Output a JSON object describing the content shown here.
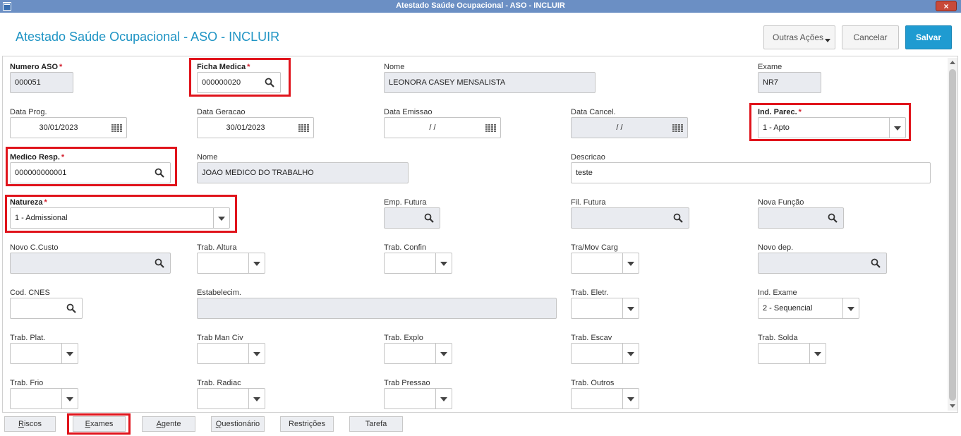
{
  "window": {
    "title": "Atestado Saúde Ocupacional - ASO - INCLUIR",
    "close_label": "×"
  },
  "header": {
    "title": "Atestado Saúde Ocupacional - ASO - INCLUIR",
    "outras_acoes": "Outras Ações",
    "cancelar": "Cancelar",
    "salvar": "Salvar"
  },
  "fields": {
    "numero_aso": {
      "label": "Numero ASO",
      "value": "000051"
    },
    "ficha_medica": {
      "label": "Ficha Medica",
      "value": "000000020"
    },
    "nome_func": {
      "label": "Nome",
      "value": "LEONORA CASEY MENSALISTA"
    },
    "exame": {
      "label": "Exame",
      "value": "NR7"
    },
    "data_prog": {
      "label": "Data Prog.",
      "value": "30/01/2023"
    },
    "data_geracao": {
      "label": "Data Geracao",
      "value": "30/01/2023"
    },
    "data_emissao": {
      "label": "Data Emissao",
      "value": "/ /"
    },
    "data_cancel": {
      "label": "Data Cancel.",
      "value": "/ /"
    },
    "ind_parec": {
      "label": "Ind. Parec.",
      "value": "1 - Apto"
    },
    "medico_resp": {
      "label": "Medico Resp.",
      "value": "000000000001"
    },
    "nome_medico": {
      "label": "Nome",
      "value": "JOAO MEDICO DO TRABALHO"
    },
    "descricao": {
      "label": "Descricao",
      "value": "teste"
    },
    "natureza": {
      "label": "Natureza",
      "value": "1 - Admissional"
    },
    "emp_futura": {
      "label": "Emp. Futura",
      "value": ""
    },
    "fil_futura": {
      "label": "Fil. Futura",
      "value": ""
    },
    "nova_funcao": {
      "label": "Nova Função",
      "value": ""
    },
    "novo_ccusto": {
      "label": "Novo C.Custo",
      "value": ""
    },
    "trab_altura": {
      "label": "Trab. Altura",
      "value": ""
    },
    "trab_confin": {
      "label": "Trab. Confin",
      "value": ""
    },
    "tra_mov_carg": {
      "label": "Tra/Mov Carg",
      "value": ""
    },
    "novo_dep": {
      "label": "Novo dep.",
      "value": ""
    },
    "cod_cnes": {
      "label": "Cod. CNES",
      "value": ""
    },
    "estabelecim": {
      "label": "Estabelecim.",
      "value": ""
    },
    "trab_eletr": {
      "label": "Trab. Eletr.",
      "value": ""
    },
    "ind_exame": {
      "label": "Ind. Exame",
      "value": "2 - Sequencial"
    },
    "trab_plat": {
      "label": "Trab. Plat.",
      "value": ""
    },
    "trab_man_civ": {
      "label": "Trab Man Civ",
      "value": ""
    },
    "trab_explo": {
      "label": "Trab. Explo",
      "value": ""
    },
    "trab_escav": {
      "label": "Trab. Escav",
      "value": ""
    },
    "trab_solda": {
      "label": "Trab. Solda",
      "value": ""
    },
    "trab_frio": {
      "label": "Trab. Frio",
      "value": ""
    },
    "trab_radiac": {
      "label": "Trab. Radiac",
      "value": ""
    },
    "trab_pressao": {
      "label": "Trab Pressao",
      "value": ""
    },
    "trab_outros": {
      "label": "Trab. Outros",
      "value": ""
    }
  },
  "footer": {
    "riscos": {
      "first": "R",
      "rest": "iscos"
    },
    "exames": {
      "first": "E",
      "rest": "xames"
    },
    "agente": {
      "first": "A",
      "rest": "gente"
    },
    "questionario": {
      "first": "Q",
      "rest": "uestionário"
    },
    "restricoes": "Restrições",
    "tarefa": "Tarefa"
  },
  "required_marker": "*",
  "colors": {
    "accent": "#1f94c4",
    "primary_button": "#1f9bd1",
    "highlight": "#e0141c",
    "readonly_bg": "#e9ebf0"
  }
}
